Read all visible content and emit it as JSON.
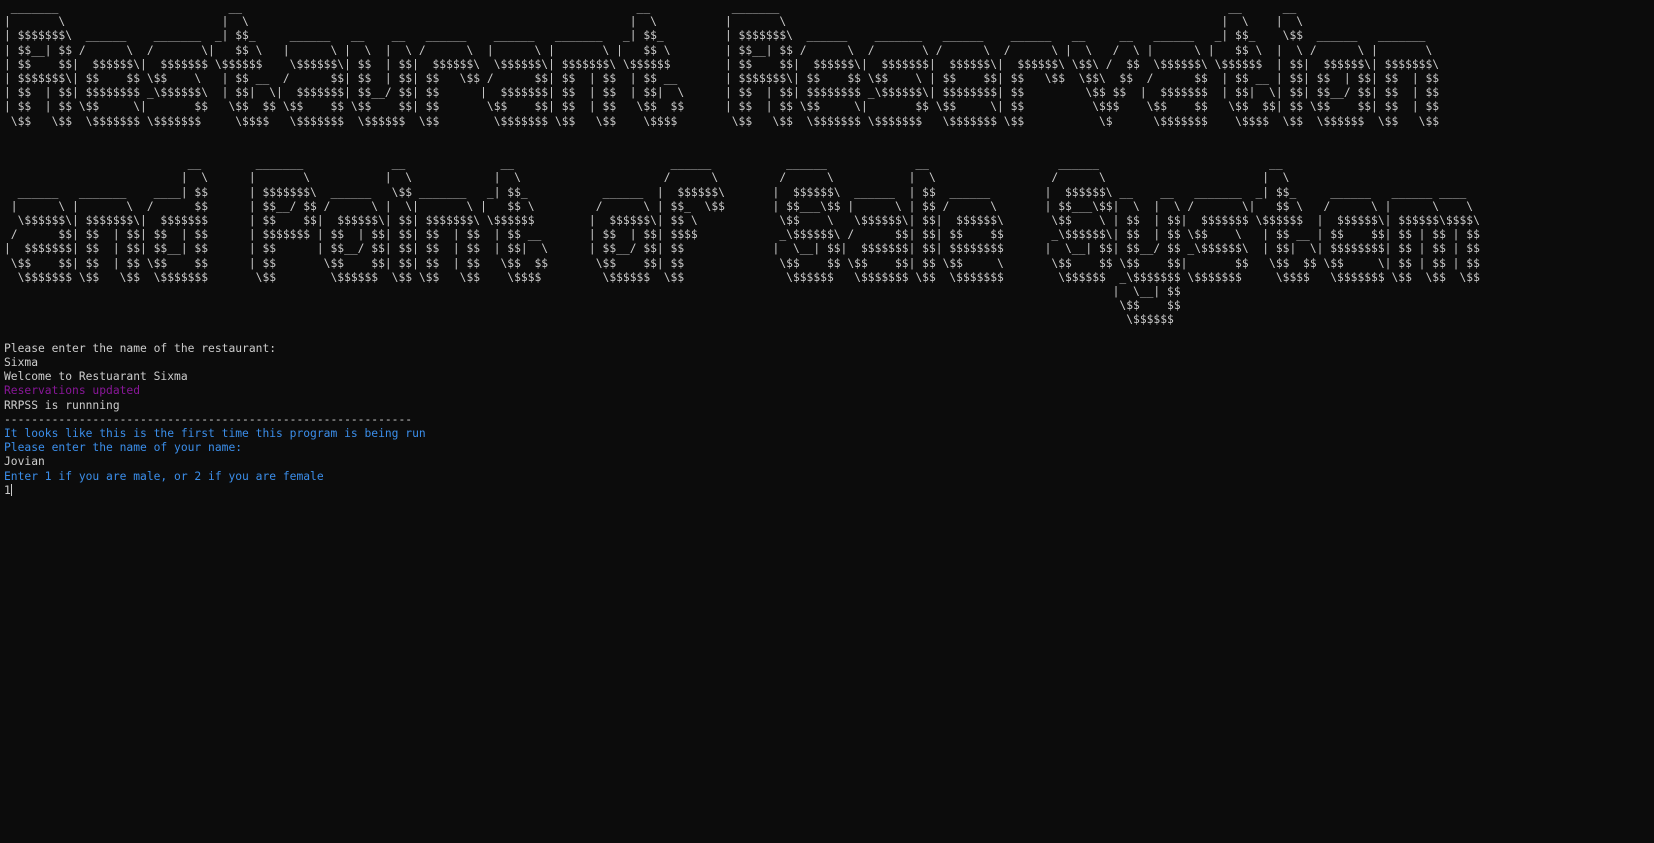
{
  "banner": {
    "line1": "Restaurant Reservation",
    "line2": "and Point of Sale System"
  },
  "output": [
    {
      "text": "Please enter the name of the restaurant:",
      "color": "default"
    },
    {
      "text": "Sixma",
      "color": "default"
    },
    {
      "text": "Welcome to Restuarant Sixma",
      "color": "default"
    },
    {
      "text": "Reservations updated",
      "color": "purple"
    },
    {
      "text": "RRPSS is runnning",
      "color": "default"
    },
    {
      "text": "------------------------------------------------------------",
      "color": "default"
    },
    {
      "text": "It looks like this is the first time this program is being run",
      "color": "blue"
    },
    {
      "text": "Please enter the name of your name:",
      "color": "blue"
    },
    {
      "text": "Jovian",
      "color": "default"
    },
    {
      "text": "Enter 1 if you are male, or 2 if you are female",
      "color": "blue"
    }
  ],
  "input_line": "1",
  "colors": {
    "background": "#0c0c0c",
    "default": "#cccccc",
    "purple": "#881798",
    "blue": "#3b8eea"
  }
}
